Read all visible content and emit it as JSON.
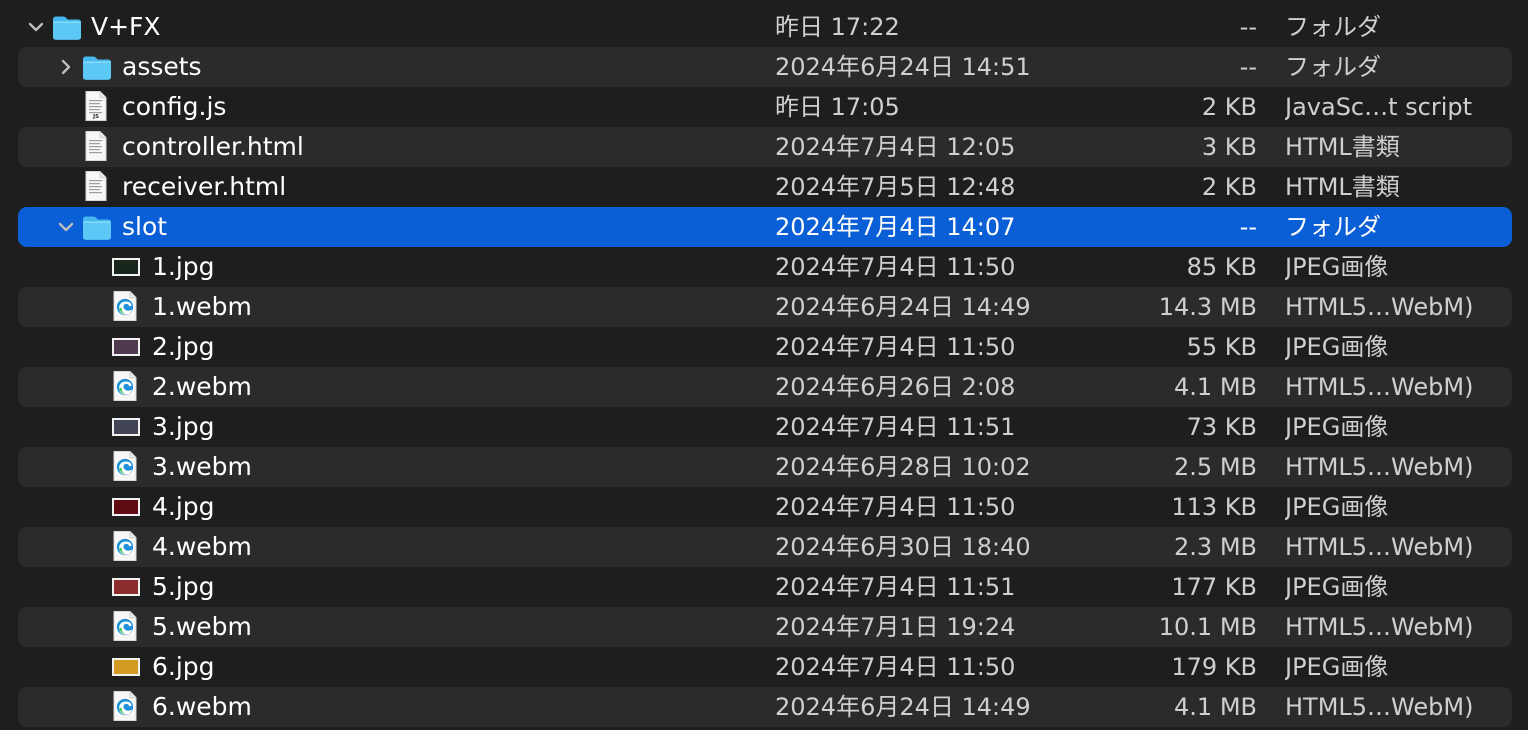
{
  "window": {
    "title": "V+FX"
  },
  "rows": [
    {
      "name": "V+FX",
      "date": "昨日 17:22",
      "size": "--",
      "kind": "フォルダ",
      "type": "folder",
      "disclosure": "open",
      "level": 0
    },
    {
      "name": "assets",
      "date": "2024年6月24日 14:51",
      "size": "--",
      "kind": "フォルダ",
      "type": "folder",
      "disclosure": "closed",
      "level": 1
    },
    {
      "name": "config.js",
      "date": "昨日 17:05",
      "size": "2 KB",
      "kind": "JavaSc…t script",
      "type": "js-file",
      "level": 1
    },
    {
      "name": "controller.html",
      "date": "2024年7月4日 12:05",
      "size": "3 KB",
      "kind": "HTML書類",
      "type": "html-file",
      "level": 1
    },
    {
      "name": "receiver.html",
      "date": "2024年7月5日 12:48",
      "size": "2 KB",
      "kind": "HTML書類",
      "type": "html-file",
      "level": 1
    },
    {
      "name": "slot",
      "date": "2024年7月4日 14:07",
      "size": "--",
      "kind": "フォルダ",
      "type": "folder",
      "disclosure": "open",
      "level": 1,
      "selected": true
    },
    {
      "name": "1.jpg",
      "date": "2024年7月4日 11:50",
      "size": "85 KB",
      "kind": "JPEG画像",
      "type": "jpg-file",
      "level": 2,
      "thumb_color": "#18261b"
    },
    {
      "name": "1.webm",
      "date": "2024年6月24日 14:49",
      "size": "14.3 MB",
      "kind": "HTML5…WebM)",
      "type": "webm-file",
      "level": 2
    },
    {
      "name": "2.jpg",
      "date": "2024年7月4日 11:50",
      "size": "55 KB",
      "kind": "JPEG画像",
      "type": "jpg-file",
      "level": 2,
      "thumb_color": "#4f3a50"
    },
    {
      "name": "2.webm",
      "date": "2024年6月26日 2:08",
      "size": "4.1 MB",
      "kind": "HTML5…WebM)",
      "type": "webm-file",
      "level": 2
    },
    {
      "name": "3.jpg",
      "date": "2024年7月4日 11:51",
      "size": "73 KB",
      "kind": "JPEG画像",
      "type": "jpg-file",
      "level": 2,
      "thumb_color": "#404455"
    },
    {
      "name": "3.webm",
      "date": "2024年6月28日 10:02",
      "size": "2.5 MB",
      "kind": "HTML5…WebM)",
      "type": "webm-file",
      "level": 2
    },
    {
      "name": "4.jpg",
      "date": "2024年7月4日 11:50",
      "size": "113 KB",
      "kind": "JPEG画像",
      "type": "jpg-file",
      "level": 2,
      "thumb_color": "#5e0b12"
    },
    {
      "name": "4.webm",
      "date": "2024年6月30日 18:40",
      "size": "2.3 MB",
      "kind": "HTML5…WebM)",
      "type": "webm-file",
      "level": 2
    },
    {
      "name": "5.jpg",
      "date": "2024年7月4日 11:51",
      "size": "177 KB",
      "kind": "JPEG画像",
      "type": "jpg-file",
      "level": 2,
      "thumb_color": "#8c2c2e"
    },
    {
      "name": "5.webm",
      "date": "2024年7月1日 19:24",
      "size": "10.1 MB",
      "kind": "HTML5…WebM)",
      "type": "webm-file",
      "level": 2
    },
    {
      "name": "6.jpg",
      "date": "2024年7月4日 11:50",
      "size": "179 KB",
      "kind": "JPEG画像",
      "type": "jpg-file",
      "level": 2,
      "thumb_color": "#d49b23"
    },
    {
      "name": "6.webm",
      "date": "2024年6月24日 14:49",
      "size": "4.1 MB",
      "kind": "HTML5…WebM)",
      "type": "webm-file",
      "level": 2
    }
  ],
  "colors": {
    "background": "#1e1e1e",
    "stripe": "#2b2b2b",
    "selection": "#0b5fd6",
    "folder_blue": "#46b8ee",
    "edge_icon_blue": "#1b8fd9",
    "edge_icon_green": "#34c759",
    "text": "#ffffff",
    "secondary_text": "#cfcfcf"
  }
}
